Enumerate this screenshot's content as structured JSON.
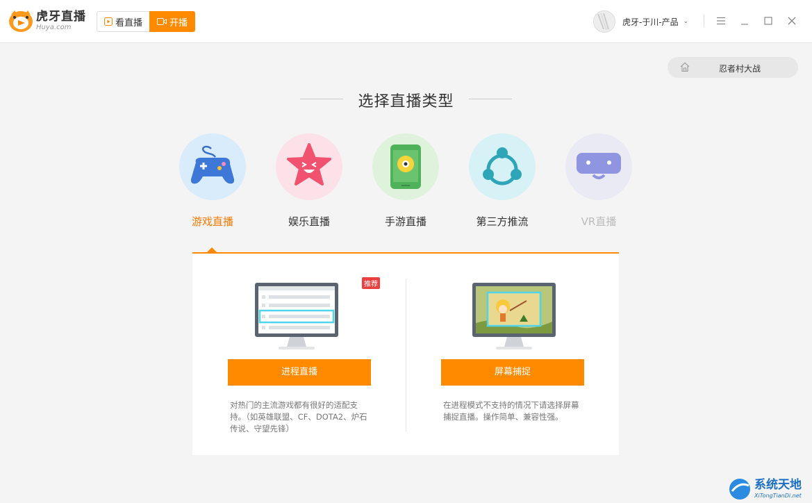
{
  "app": {
    "logo_cn": "虎牙直播",
    "logo_en": "Huya.com"
  },
  "modes": {
    "watch": "看直播",
    "live": "开播"
  },
  "user": {
    "name": "虎牙-于川-产品"
  },
  "breadcrumb": {
    "text": "忍者村大战"
  },
  "heading": "选择直播类型",
  "categories": [
    {
      "label": "游戏直播",
      "icon": "gamepad-icon"
    },
    {
      "label": "娱乐直播",
      "icon": "star-face-icon"
    },
    {
      "label": "手游直播",
      "icon": "phone-icon"
    },
    {
      "label": "第三方推流",
      "icon": "share-nodes-icon"
    },
    {
      "label": "VR直播",
      "icon": "vr-headset-icon"
    }
  ],
  "options": {
    "process": {
      "button": "进程直播",
      "badge": "推荐",
      "desc": "对热门的主流游戏都有很好的适配支持。（如英雄联盟、CF、DOTA2、炉石传说、守望先锋）"
    },
    "screen": {
      "button": "屏幕捕捉",
      "desc": "在进程模式不支持的情况下请选择屏幕捕捉直播。操作简单、兼容性强。"
    }
  },
  "watermark": {
    "title": "系统天地",
    "sub": "XiTongTianDi.net"
  },
  "colors": {
    "accent": "#ff8a00",
    "active_label": "#ff7800"
  }
}
